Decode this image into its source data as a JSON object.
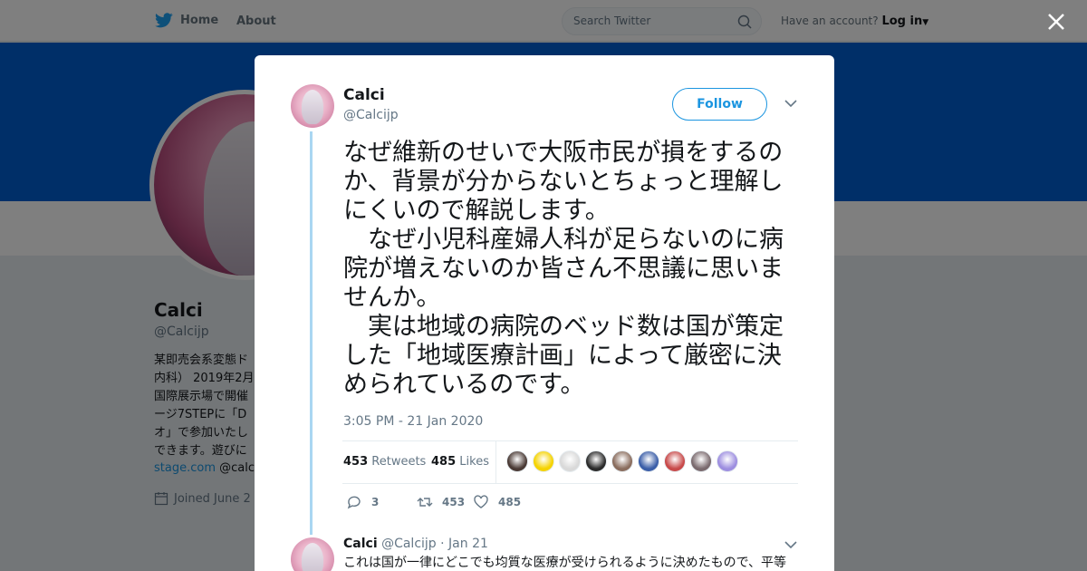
{
  "topnav": {
    "home_label": "Home",
    "about_label": "About",
    "search_placeholder": "Search Twitter",
    "have_account": "Have an account?",
    "login_label": "Log in"
  },
  "profile": {
    "name": "Calci",
    "handle": "@Calcijp",
    "bio": "某即売会系変態ド\n内科） 2019年2月\n国際展示場で開催\nージ7STEPに「D\nオ」で参加いたし\nできます。遊びに",
    "link_text": "stage.com",
    "link_suffix": " @calci",
    "joined": "Joined June 2"
  },
  "tweet": {
    "author_name": "Calci",
    "author_handle": "@Calcijp",
    "follow_label": "Follow",
    "text": "なぜ維新のせいで大阪市民が損をするのか、背景が分からないとちょっと理解しにくいので解説します。\n　なぜ小児科産婦人科が足らないのに病院が増えないのか皆さん不思議に思いませんか。\n　実は地域の病院のベッド数は国が策定した「地域医療計画」によって厳密に決められているのです。",
    "timestamp": "3:05 PM - 21 Jan 2020",
    "retweets_count": "453",
    "retweets_label": "Retweets",
    "likes_count": "485",
    "likes_label": "Likes",
    "reply_count": "3",
    "retweet_action_count": "453",
    "like_action_count": "485"
  },
  "likers": [
    {
      "color": "#4a3a35"
    },
    {
      "color": "#f5d300"
    },
    {
      "color": "#d9d9d9"
    },
    {
      "color": "#2b2b2b"
    },
    {
      "color": "#8a6d5e"
    },
    {
      "color": "#3b5ea8"
    },
    {
      "color": "#c84a4a"
    },
    {
      "color": "#7a6a6e"
    },
    {
      "color": "#9d8ee0"
    }
  ],
  "reply": {
    "author_name": "Calci",
    "author_handle": "@Calcijp",
    "date": "· Jan 21",
    "text": "これは国が一律にどこでも均質な医療が受けられるように決めたもので、平等"
  },
  "colors": {
    "brand": "#1da1f2",
    "banner": "#005fd1",
    "link": "#1b95e0"
  }
}
